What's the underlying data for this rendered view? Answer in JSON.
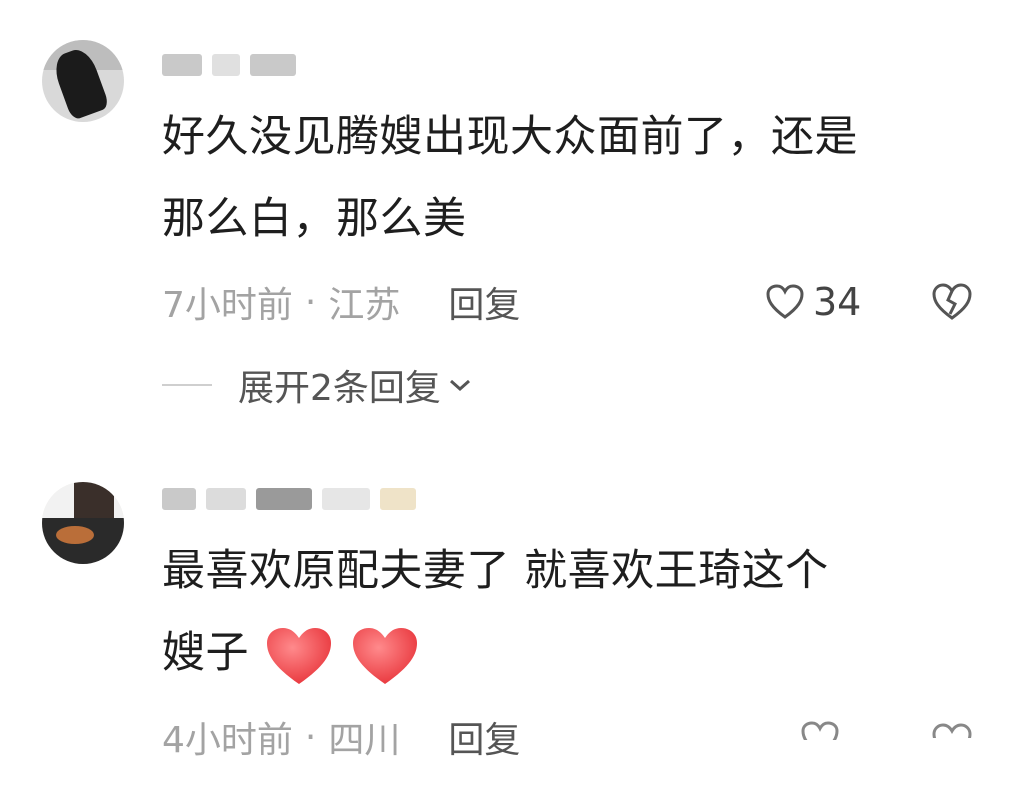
{
  "comments": [
    {
      "text_line1": "好久没见腾嫂出现大众面前了，还是",
      "text_line2": "那么白，那么美",
      "time": "7小时前",
      "separator": "·",
      "location": "江苏",
      "reply_label": "回复",
      "like_count": "34",
      "expand_label": "展开2条回复"
    },
    {
      "text_line1": "最喜欢原配夫妻了 就喜欢王琦这个",
      "text_line2": "嫂子",
      "time": "4小时前",
      "separator": "·",
      "location": "四川",
      "reply_label": "回复"
    }
  ],
  "icons": [
    "heart-outline-icon",
    "dislike-broken-heart-icon",
    "chevron-down-icon",
    "red-heart-emoji"
  ],
  "colors": {
    "text": "#1e1e1e",
    "meta": "#a3a3a3",
    "reply": "#555555",
    "heart_red": "#f0575a"
  }
}
